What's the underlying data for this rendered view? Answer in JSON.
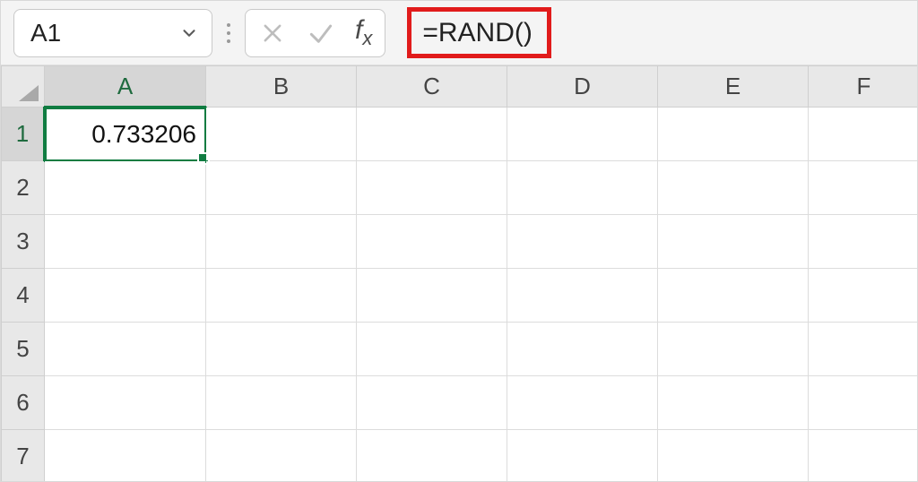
{
  "name_box": {
    "value": "A1"
  },
  "formula_bar": {
    "value": "=RAND()"
  },
  "columns": [
    "A",
    "B",
    "C",
    "D",
    "E",
    "F"
  ],
  "rows": [
    "1",
    "2",
    "3",
    "4",
    "5",
    "6",
    "7"
  ],
  "active_col_index": 0,
  "active_row_index": 0,
  "cells": {
    "A1": "0.733206"
  },
  "colors": {
    "accent": "#107c41",
    "highlight": "#e11b1b"
  }
}
